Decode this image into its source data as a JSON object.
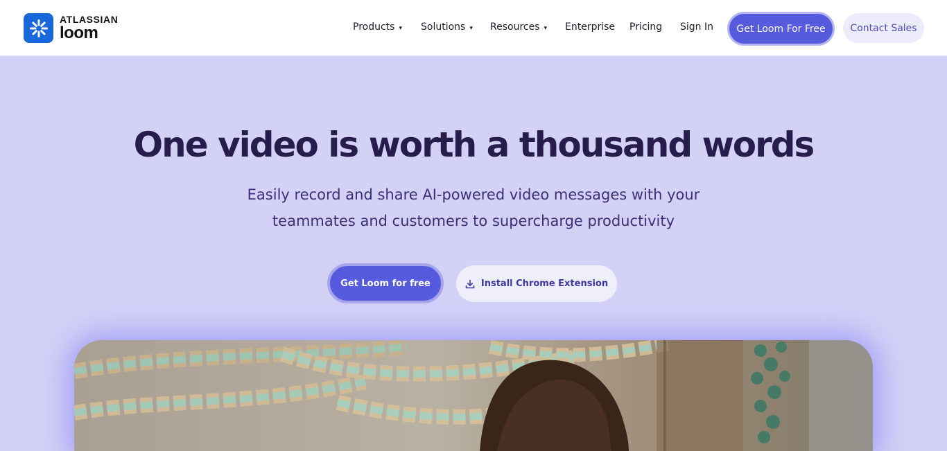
{
  "brand": {
    "company": "ATLASSIAN",
    "product": "loom",
    "color": "#1868db"
  },
  "nav": {
    "items": [
      {
        "label": "Products",
        "has_caret": true
      },
      {
        "label": "Solutions",
        "has_caret": true
      },
      {
        "label": "Resources",
        "has_caret": true
      },
      {
        "label": "Enterprise",
        "has_caret": false
      },
      {
        "label": "Pricing",
        "has_caret": false
      },
      {
        "label": "Sign In",
        "has_caret": false
      }
    ],
    "caret_glyph": "▾",
    "primary_button": "Get Loom For Free",
    "secondary_button": "Contact Sales"
  },
  "hero": {
    "title": "One video is worth a thousand words",
    "subtitle_line1": "Easily record and share AI-powered video messages with your",
    "subtitle_line2": "teammates and customers to supercharge productivity",
    "cta_primary": "Get Loom for free",
    "cta_secondary": "Install Chrome Extension",
    "cta_secondary_icon": "download-icon"
  },
  "media": {
    "description_icon": "hero-video-image"
  },
  "colors": {
    "accent": "#565add",
    "hero_background": "#d3d1f6",
    "title": "#271c4b"
  }
}
